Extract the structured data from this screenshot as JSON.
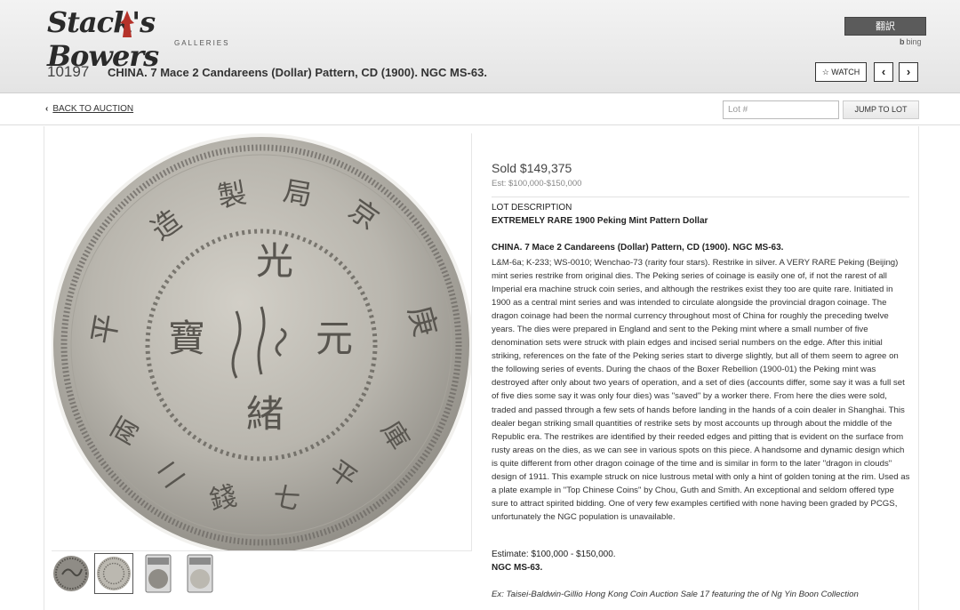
{
  "header": {
    "logo_text": "Stack's Bowers",
    "logo_subtext": "GALLERIES",
    "translate_label": "翻訳",
    "bing_label": "bing",
    "watch_label": "WATCH",
    "prev_label": "‹",
    "next_label": "›"
  },
  "lot": {
    "number": "10197",
    "title": "CHINA. 7 Mace 2 Candareens (Dollar) Pattern, CD (1900). NGC MS-63."
  },
  "subnav": {
    "back_label": "BACK TO AUCTION",
    "lot_input_placeholder": "Lot #",
    "jump_label": "JUMP TO LOT"
  },
  "pricing": {
    "sold": "Sold $149,375",
    "estimate": "Est: $100,000-$150,000"
  },
  "description": {
    "heading": "LOT DESCRIPTION",
    "subheading": "EXTREMELY RARE 1900 Peking Mint Pattern Dollar",
    "title": "CHINA. 7 Mace 2 Candareens (Dollar) Pattern, CD (1900). NGC MS-63.",
    "body": "L&M-6a; K-233; WS-0010; Wenchao-73 (rarity four stars). Restrike in silver. A VERY RARE Peking (Beijing) mint series restrike from original dies. The Peking series of coinage is easily one of, if not the rarest of all Imperial era machine struck coin series, and although the restrikes exist they too are quite rare. Initiated in 1900 as a central mint series and was intended to circulate alongside the provincial dragon coinage. The dragon coinage had been the normal currency throughout most of China for roughly the preceding twelve years. The dies were prepared in England and sent to the Peking mint where a small number of five denomination sets were struck with plain edges and incised serial numbers on the edge. After this initial striking, references on the fate of the Peking series start to diverge slightly, but all of them seem to agree on the following series of events. During the chaos of the Boxer Rebellion (1900-01) the Peking mint was destroyed after only about two years of operation, and a set of dies (accounts differ, some say it was a full set of five dies some say it was only four dies) was \"saved\" by a worker there. From here the dies were sold, traded and passed through a few sets of hands before landing in the hands of a coin dealer in Shanghai. This dealer began striking small quantities of restrike sets by most accounts up through about the middle of the Republic era. The restrikes are identified by their reeded edges and pitting that is evident on the surface from rusty areas on the dies, as we can see in various spots on this piece. A handsome and dynamic design which is quite different from other dragon coinage of the time and is similar in form to the later \"dragon in clouds\" design of 1911. This example struck on nice lustrous metal with only a hint of golden toning at the rim. Used as a plate example in \"Top Chinese Coins\" by Chou, Guth and Smith. An exceptional and seldom offered type sure to attract spirited bidding. One of very few examples certified with none having been graded by PCGS, unfortunately the NGC population is unavailable.",
    "estimate_line": "Estimate: $100,000 - $150,000.",
    "grade_line": "NGC MS-63.",
    "provenance": "Ex: Taisei-Baldwin-Gillio Hong Kong Coin Auction Sale 17 featuring the of Ng Yin Boon Collection"
  },
  "coin": {
    "center_chars": [
      "光",
      "緒",
      "元",
      "寶"
    ],
    "rim_top": [
      "造",
      "製",
      "局",
      "京"
    ],
    "rim_left": "平",
    "rim_right": "庚",
    "rim_bottom": [
      "兩",
      "二",
      "錢",
      "七",
      "平",
      "庫"
    ]
  },
  "colors": {
    "coin_base": "#b9b6ae",
    "topbar": "#e9e9e9",
    "button_dark": "#5b5b5b",
    "logo_accent": "#b5322a"
  },
  "thumbnails": [
    {
      "name": "obverse-dragon-thumbnail",
      "selected": false
    },
    {
      "name": "reverse-characters-thumbnail",
      "selected": true
    },
    {
      "name": "slab-front-thumbnail",
      "selected": false
    },
    {
      "name": "slab-back-thumbnail",
      "selected": false
    }
  ]
}
